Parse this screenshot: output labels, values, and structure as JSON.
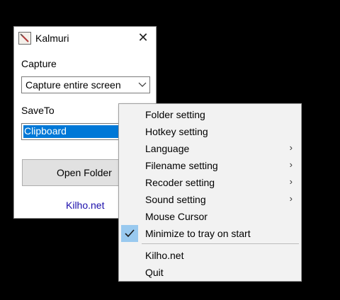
{
  "window": {
    "title": "Kalmuri",
    "capture_label": "Capture",
    "capture_value": "Capture entire screen",
    "saveto_label": "SaveTo",
    "saveto_value": "Clipboard",
    "open_folder_label": "Open Folder",
    "link_text": "Kilho.net",
    "icons": {
      "app": "kalmuri-app-icon",
      "close": "close-icon",
      "dropdown": "chevron-down-icon"
    }
  },
  "menu": {
    "items": [
      {
        "label": "Folder setting",
        "submenu": false,
        "checked": false
      },
      {
        "label": "Hotkey setting",
        "submenu": false,
        "checked": false
      },
      {
        "label": "Language",
        "submenu": true,
        "checked": false
      },
      {
        "label": "Filename setting",
        "submenu": true,
        "checked": false
      },
      {
        "label": "Recoder setting",
        "submenu": true,
        "checked": false
      },
      {
        "label": "Sound setting",
        "submenu": true,
        "checked": false
      },
      {
        "label": "Mouse Cursor",
        "submenu": false,
        "checked": false
      },
      {
        "label": "Minimize to tray on start",
        "submenu": false,
        "checked": true
      },
      {
        "label": "Kilho.net",
        "submenu": false,
        "checked": false
      },
      {
        "label": "Quit",
        "submenu": false,
        "checked": false
      }
    ],
    "submenu_glyph": "›",
    "colors": {
      "highlight": "#0078d7",
      "check_bg": "#99c9ef"
    }
  }
}
